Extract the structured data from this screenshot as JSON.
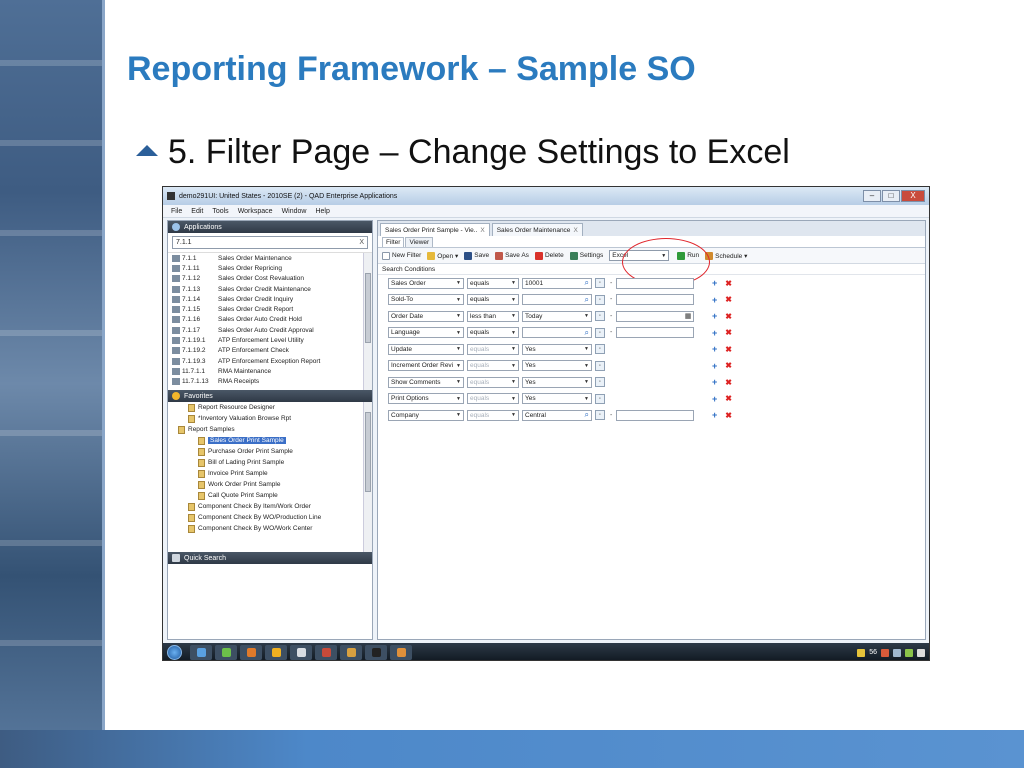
{
  "slide": {
    "title": "Reporting Framework – Sample SO",
    "bullet": "5.  Filter Page – Change Settings to Excel"
  },
  "window": {
    "title": "demo291UI: United States - 2010SE (2) - QAD Enterprise Applications",
    "buttons": [
      "–",
      "□",
      "X"
    ]
  },
  "menubar": [
    "File",
    "Edit",
    "Tools",
    "Workspace",
    "Window",
    "Help"
  ],
  "applications": {
    "header": "Applications",
    "search_value": "7.1.1",
    "search_clear": "X",
    "items": [
      {
        "num": "7.1.1",
        "label": "Sales Order Maintenance"
      },
      {
        "num": "7.1.11",
        "label": "Sales Order Repricing"
      },
      {
        "num": "7.1.12",
        "label": "Sales Order Cost Revaluation"
      },
      {
        "num": "7.1.13",
        "label": "Sales Order Credit Maintenance"
      },
      {
        "num": "7.1.14",
        "label": "Sales Order Credit Inquiry"
      },
      {
        "num": "7.1.15",
        "label": "Sales Order Credit Report"
      },
      {
        "num": "7.1.16",
        "label": "Sales Order Auto Credit Hold"
      },
      {
        "num": "7.1.17",
        "label": "Sales Order Auto Credit Approval"
      },
      {
        "num": "7.1.19.1",
        "label": "ATP Enforcement Level Utility"
      },
      {
        "num": "7.1.19.2",
        "label": "ATP Enforcement Check"
      },
      {
        "num": "7.1.19.3",
        "label": "ATP Enforcement Exception Report"
      },
      {
        "num": "11.7.1.1",
        "label": "RMA Maintenance"
      },
      {
        "num": "11.7.1.13",
        "label": "RMA Receipts"
      }
    ]
  },
  "favorites": {
    "header": "Favorites",
    "items": [
      {
        "label": "Report Resource Designer",
        "indent": 1
      },
      {
        "label": "*Inventory Valuation Browse Rpt",
        "indent": 1
      },
      {
        "label": "Report Samples",
        "indent": 0
      },
      {
        "label": "Sales Order Print Sample",
        "indent": 2,
        "selected": true
      },
      {
        "label": "Purchase Order Print Sample",
        "indent": 2
      },
      {
        "label": "Bill of Lading Print Sample",
        "indent": 2
      },
      {
        "label": "Invoice Print Sample",
        "indent": 2
      },
      {
        "label": "Work Order Print Sample",
        "indent": 2
      },
      {
        "label": "Call Quote Print Sample",
        "indent": 2
      },
      {
        "label": "Component Check By Item/Work Order",
        "indent": 1
      },
      {
        "label": "Component Check By WO/Production Line",
        "indent": 1
      },
      {
        "label": "Component Check By WO/Work Center",
        "indent": 1
      }
    ]
  },
  "quick_search": {
    "header": "Quick Search"
  },
  "doc_tabs": [
    {
      "label": "Sales Order Print Sample - Vie..",
      "close": "X",
      "active": true
    },
    {
      "label": "Sales Order Maintenance",
      "close": "X",
      "active": false
    }
  ],
  "sub_tabs": [
    "Filter",
    "Viewer"
  ],
  "toolbar": {
    "new_filter": "New Filter",
    "open": "Open ▾",
    "save": "Save",
    "save_as": "Save As",
    "delete": "Delete",
    "settings": "Settings",
    "output_format": "Excel",
    "run": "Run",
    "schedule": "Schedule ▾"
  },
  "search_conditions": {
    "header": "Search Conditions",
    "rows": [
      {
        "field": "Sales Order",
        "operator": "equals",
        "op_enabled": true,
        "value": "10001",
        "value_type": "lookup",
        "range": true
      },
      {
        "field": "Sold-To",
        "operator": "equals",
        "op_enabled": true,
        "value": "",
        "value_type": "lookup",
        "range": true
      },
      {
        "field": "Order Date",
        "operator": "less than",
        "op_enabled": true,
        "value": "Today",
        "value_type": "date",
        "range": true
      },
      {
        "field": "Language",
        "operator": "equals",
        "op_enabled": true,
        "value": "",
        "value_type": "lookup",
        "range": true
      },
      {
        "field": "Update",
        "operator": "equals",
        "op_enabled": false,
        "value": "Yes",
        "value_type": "select",
        "range": false
      },
      {
        "field": "Increment Order Revi",
        "operator": "equals",
        "op_enabled": false,
        "value": "Yes",
        "value_type": "select",
        "range": false
      },
      {
        "field": "Show Comments",
        "operator": "equals",
        "op_enabled": false,
        "value": "Yes",
        "value_type": "select",
        "range": false
      },
      {
        "field": "Print Options",
        "operator": "equals",
        "op_enabled": false,
        "value": "Yes",
        "value_type": "select",
        "range": false
      },
      {
        "field": "Company",
        "operator": "equals",
        "op_enabled": false,
        "value": "Central",
        "value_type": "lookup",
        "range": true
      }
    ]
  },
  "taskbar": {
    "tray_text": "56"
  }
}
